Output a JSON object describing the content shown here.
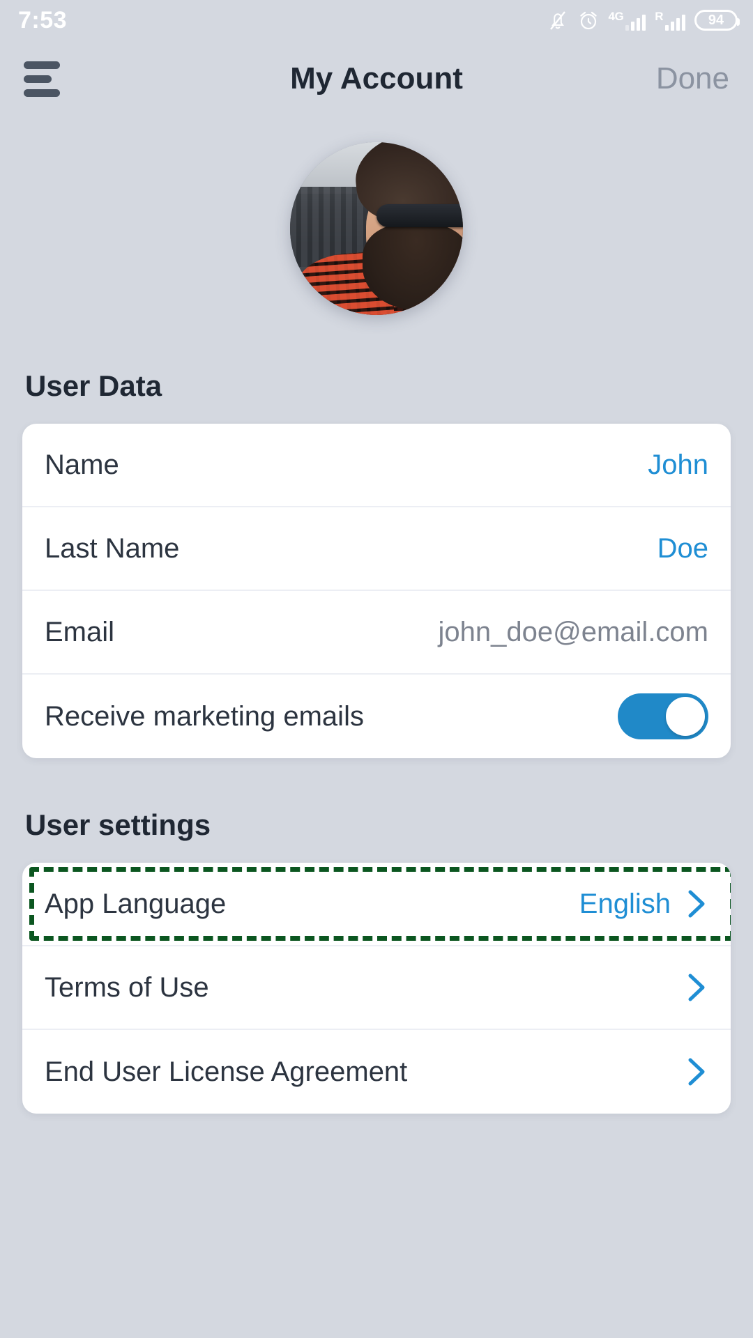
{
  "status_bar": {
    "time": "7:53",
    "battery_percent": "94",
    "network_label": "4G",
    "roaming_label": "R",
    "icons": [
      "bell-muted-icon",
      "alarm-clock-icon",
      "signal-4g-icon",
      "signal-roaming-icon",
      "battery-icon"
    ]
  },
  "nav": {
    "menu_icon": "hamburger-menu-icon",
    "title": "My Account",
    "done_label": "Done"
  },
  "avatar": {
    "alt": "user-profile-photo"
  },
  "sections": [
    {
      "title": "User Data",
      "rows": [
        {
          "label": "Name",
          "value": "John",
          "type": "value"
        },
        {
          "label": "Last Name",
          "value": "Doe",
          "type": "value"
        },
        {
          "label": "Email",
          "value": "john_doe@email.com",
          "type": "value-muted"
        },
        {
          "label": "Receive marketing emails",
          "value": "on",
          "type": "toggle"
        }
      ]
    },
    {
      "title": "User settings",
      "rows": [
        {
          "label": "App Language",
          "value": "English",
          "type": "nav",
          "highlighted": true
        },
        {
          "label": "Terms of Use",
          "value": "",
          "type": "nav",
          "highlighted": false
        },
        {
          "label": "End User License Agreement",
          "value": "",
          "type": "nav",
          "highlighted": false
        }
      ]
    }
  ],
  "colors": {
    "page_background": "#d4d8e0",
    "card_background": "#ffffff",
    "accent_blue": "#1f8ed4",
    "toggle_on": "#2089c8",
    "highlight_green": "#0b5620",
    "label_text": "#2c3440",
    "muted_text": "#7d838f",
    "done_text": "#8b93a1"
  }
}
